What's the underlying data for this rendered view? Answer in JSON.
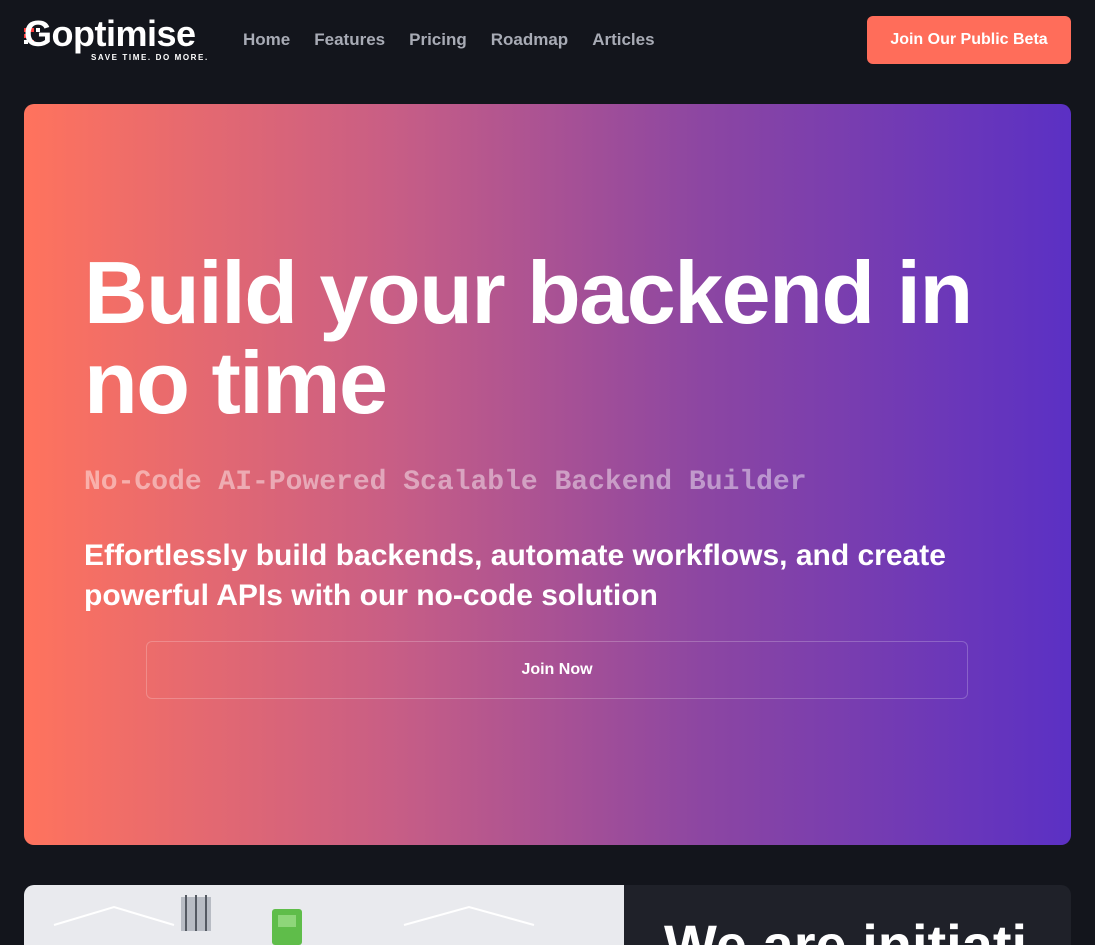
{
  "brand": {
    "name": "Goptimise",
    "tagline": "SAVE TIME. DO MORE.",
    "dot_color": "#ff3b3b"
  },
  "nav": {
    "items": [
      {
        "label": "Home"
      },
      {
        "label": "Features"
      },
      {
        "label": "Pricing"
      },
      {
        "label": "Roadmap"
      },
      {
        "label": "Articles"
      }
    ],
    "cta_label": "Join Our Public Beta"
  },
  "hero": {
    "title": "Build your backend in no time",
    "subtitle": "No-Code AI-Powered Scalable Backend Builder",
    "description": "Effortlessly build backends, automate workflows, and create powerful APIs with our no-code solution",
    "button_label": "Join Now",
    "gradient_start": "#ff735d",
    "gradient_end": "#5b30c4"
  },
  "next_section": {
    "heading_partial": "We are initiati"
  },
  "colors": {
    "background": "#13151c",
    "accent": "#ff6d5a",
    "nav_text": "#a8abb5"
  }
}
